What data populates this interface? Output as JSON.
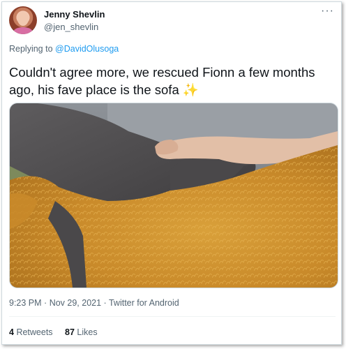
{
  "author": {
    "name": "Jenny Shevlin",
    "handle": "@jen_shevlin"
  },
  "more_icon": "more-horizontal-icon",
  "replying": {
    "prefix": "Replying to",
    "target": "@DavidOlusoga"
  },
  "tweet": {
    "text_line1": "Couldn't agree more, we rescued Fionn a few months",
    "text_line2": "ago, his fave place is the sofa",
    "emoji": "✨"
  },
  "meta": {
    "time": "9:23 PM",
    "separator1": "·",
    "date": "Nov 29, 2021",
    "separator2": "·",
    "source": "Twitter for Android"
  },
  "stats": {
    "retweets_count": "4",
    "retweets_label": "Retweets",
    "likes_count": "87",
    "likes_label": "Likes"
  },
  "colors": {
    "link": "#1d9bf0",
    "secondary_text": "#536471",
    "primary_text": "#0f1419"
  }
}
